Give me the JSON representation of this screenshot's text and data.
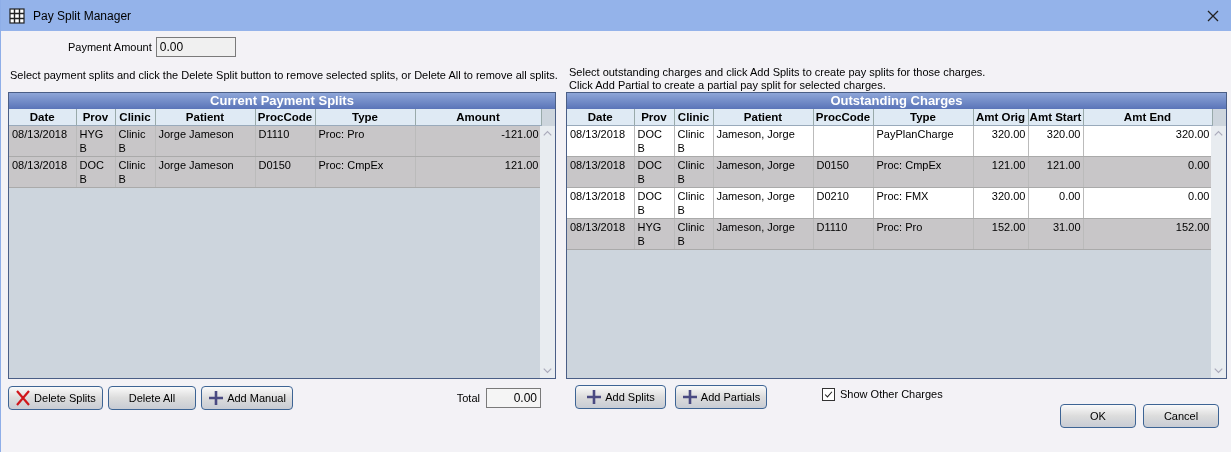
{
  "window": {
    "title": "Pay Split Manager"
  },
  "payment_amount": {
    "label": "Payment Amount",
    "value": "0.00"
  },
  "left": {
    "instructions": [
      "Select payment splits and click the Delete Split button to remove selected splits, or Delete All to remove all splits."
    ],
    "grid": {
      "title": "Current Payment Splits",
      "columns": [
        "Date",
        "Prov",
        "Clinic",
        "Patient",
        "ProcCode",
        "Type",
        "Amount"
      ],
      "rows": [
        {
          "cells": [
            "08/13/2018",
            "HYG B",
            "Clinic B",
            "Jorge Jameson",
            "D1110",
            "Proc:  Pro",
            "-121.00"
          ],
          "selected": true
        },
        {
          "cells": [
            "08/13/2018",
            "DOC B",
            "Clinic B",
            "Jorge Jameson",
            "D0150",
            "Proc:  CmpEx",
            "121.00"
          ],
          "selected": true
        }
      ]
    },
    "buttons": [
      {
        "label": "Delete Splits",
        "kind": "delete"
      },
      {
        "label": "Delete All",
        "kind": "plain"
      },
      {
        "label": "Add Manual",
        "kind": "add"
      }
    ],
    "total": {
      "label": "Total",
      "value": "0.00"
    }
  },
  "right": {
    "instructions": [
      "Select outstanding charges and click Add Splits to create pay splits for those charges.",
      "Click Add Partial to create a partial pay split for selected charges."
    ],
    "grid": {
      "title": "Outstanding Charges",
      "columns": [
        "Date",
        "Prov",
        "Clinic",
        "Patient",
        "ProcCode",
        "Type",
        "Amt Orig",
        "Amt Start",
        "Amt End"
      ],
      "rows": [
        {
          "cells": [
            "08/13/2018",
            "DOC B",
            "Clinic B",
            "Jameson, Jorge",
            "",
            "PayPlanCharge",
            "320.00",
            "320.00",
            "320.00"
          ],
          "selected": false
        },
        {
          "cells": [
            "08/13/2018",
            "DOC B",
            "Clinic B",
            "Jameson, Jorge",
            "D0150",
            "Proc:  CmpEx",
            "121.00",
            "121.00",
            "0.00"
          ],
          "selected": true
        },
        {
          "cells": [
            "08/13/2018",
            "DOC B",
            "Clinic B",
            "Jameson, Jorge",
            "D0210",
            "Proc:  FMX",
            "320.00",
            "0.00",
            "0.00"
          ],
          "selected": false
        },
        {
          "cells": [
            "08/13/2018",
            "HYG B",
            "Clinic B",
            "Jameson, Jorge",
            "D1110",
            "Proc:  Pro",
            "152.00",
            "31.00",
            "152.00"
          ],
          "selected": true
        }
      ]
    },
    "buttons": [
      {
        "label": "Add Splits",
        "kind": "add"
      },
      {
        "label": "Add Partials",
        "kind": "add"
      }
    ],
    "show_other_charges": {
      "label": "Show Other Charges",
      "checked": true
    }
  },
  "dialog_buttons": [
    "OK",
    "Cancel"
  ]
}
